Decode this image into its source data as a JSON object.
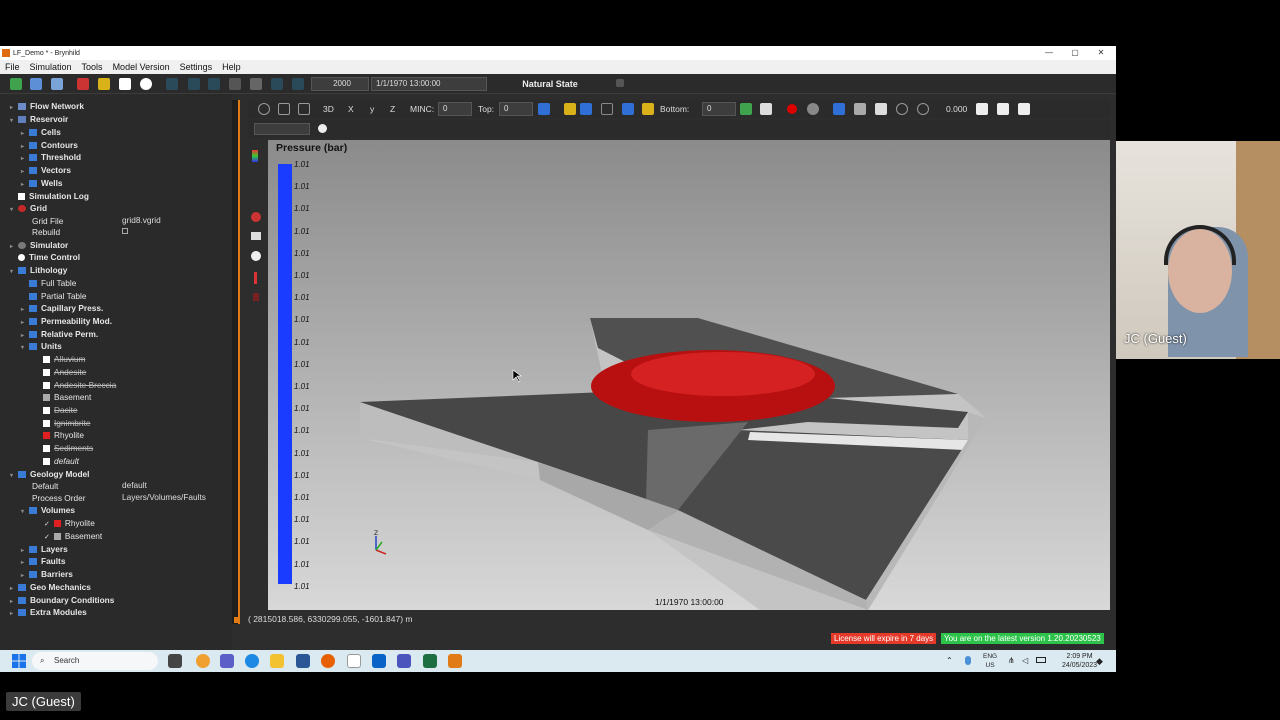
{
  "window": {
    "title": "LF_Demo * - Brynhild",
    "minimize": "—",
    "maximize": "▢",
    "close": "✕"
  },
  "menu": [
    "File",
    "Simulation",
    "Tools",
    "Model Version",
    "Settings",
    "Help"
  ],
  "toolbar": {
    "step_value": "2000",
    "date_value": "1/1/1970 13:00:00",
    "state_label": "Natural State"
  },
  "viewport_toolbar": {
    "mode_3d": "3D",
    "x": "X",
    "y": "y",
    "z": "Z",
    "minc_label": "MINC:",
    "minc_value": "0",
    "top_label": "Top:",
    "top_value": "0",
    "bottom_label": "Bottom:",
    "bottom_value": "0",
    "opacity_value": "0.000"
  },
  "tree": {
    "flow_network": "Flow Network",
    "reservoir": "Reservoir",
    "cells": "Cells",
    "contours": "Contours",
    "threshold": "Threshold",
    "vectors": "Vectors",
    "wells": "Wells",
    "simulation_log": "Simulation Log",
    "grid": "Grid",
    "grid_file_label": "Grid File",
    "grid_file_value": "grid8.vgrid",
    "rebuild_label": "Rebuild",
    "simulator": "Simulator",
    "time_control": "Time Control",
    "lithology": "Lithology",
    "full_table": "Full Table",
    "partial_table": "Partial Table",
    "capillary": "Capillary Press.",
    "permeability": "Permeability Mod.",
    "relative_perm": "Relative Perm.",
    "units": "Units",
    "unit_items": [
      "Alluvium",
      "Andesite",
      "Andesite Breccia",
      "Basement",
      "Dacite",
      "Ignimbrite",
      "Rhyolite",
      "Sediments",
      "default"
    ],
    "geology_model": "Geology Model",
    "default_label": "Default",
    "default_value": "default",
    "process_order_label": "Process Order",
    "process_order_value": "Layers/Volumes/Faults",
    "volumes": "Volumes",
    "volume_items": [
      "Rhyolite",
      "Basement"
    ],
    "layers": "Layers",
    "faults": "Faults",
    "barriers": "Barriers",
    "geo_mechanics": "Geo Mechanics",
    "boundary_conditions": "Boundary Conditions",
    "extra_modules": "Extra Modules"
  },
  "viewport": {
    "legend_title": "Pressure (bar)",
    "legend_labels": [
      "1.01",
      "1.01",
      "1.01",
      "1.01",
      "1.01",
      "1.01",
      "1.01",
      "1.01",
      "1.01",
      "1.01",
      "1.01",
      "1.01",
      "1.01",
      "1.01",
      "1.01",
      "1.01",
      "1.01",
      "1.01",
      "1.01",
      "1.01"
    ],
    "timestamp": "1/1/1970 13:00:00",
    "axis_z": "Z"
  },
  "coords": "(  2815018.586,    6330299.055,    -1601.847) m",
  "status": {
    "license": "License will expire in 7 days",
    "version": "You are on the latest version 1.20.20230523"
  },
  "taskbar": {
    "search_placeholder": "Search",
    "lang_line1": "ENG",
    "lang_line2": "US",
    "time": "2:09 PM",
    "date": "24/05/2023"
  },
  "webcam": {
    "name": "JC (Guest)"
  },
  "participant_label": "JC (Guest)",
  "colors": {
    "accent_orange": "#e07b16",
    "legend_blue": "#1a3cff",
    "rhyolite_red": "#e02020",
    "license_red": "#e53a2a",
    "version_green": "#2dc34a"
  }
}
